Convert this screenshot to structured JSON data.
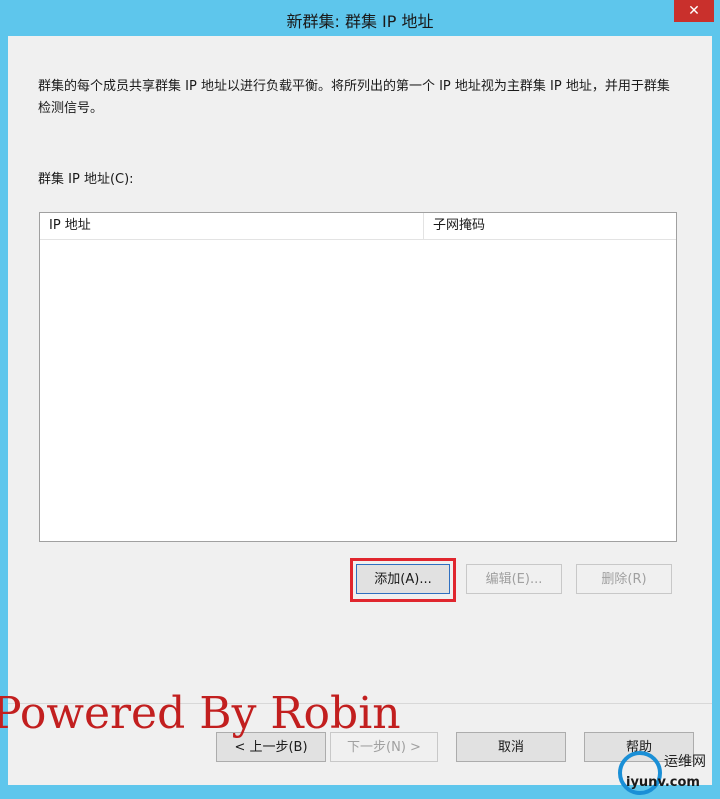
{
  "window": {
    "title": "新群集: 群集 IP 地址",
    "close_label": "✕"
  },
  "description": "群集的每个成员共享群集 IP 地址以进行负载平衡。将所列出的第一个 IP 地址视为主群集 IP 地址，并用于群集检测信号。",
  "list": {
    "label": "群集 IP 地址(C):",
    "columns": [
      "IP 地址",
      "子网掩码"
    ]
  },
  "buttons": {
    "add": "添加(A)...",
    "edit": "编辑(E)...",
    "delete": "删除(R)",
    "back": "< 上一步(B)",
    "next": "下一步(N) >",
    "cancel": "取消",
    "help": "帮助"
  },
  "watermark": "Powered By Robin",
  "logo": {
    "cn": "运维网",
    "en": "iyunv.com"
  },
  "colors": {
    "titlebar": "#5ec6ec",
    "highlight": "#e0262e",
    "watermark": "#c21f1f"
  }
}
